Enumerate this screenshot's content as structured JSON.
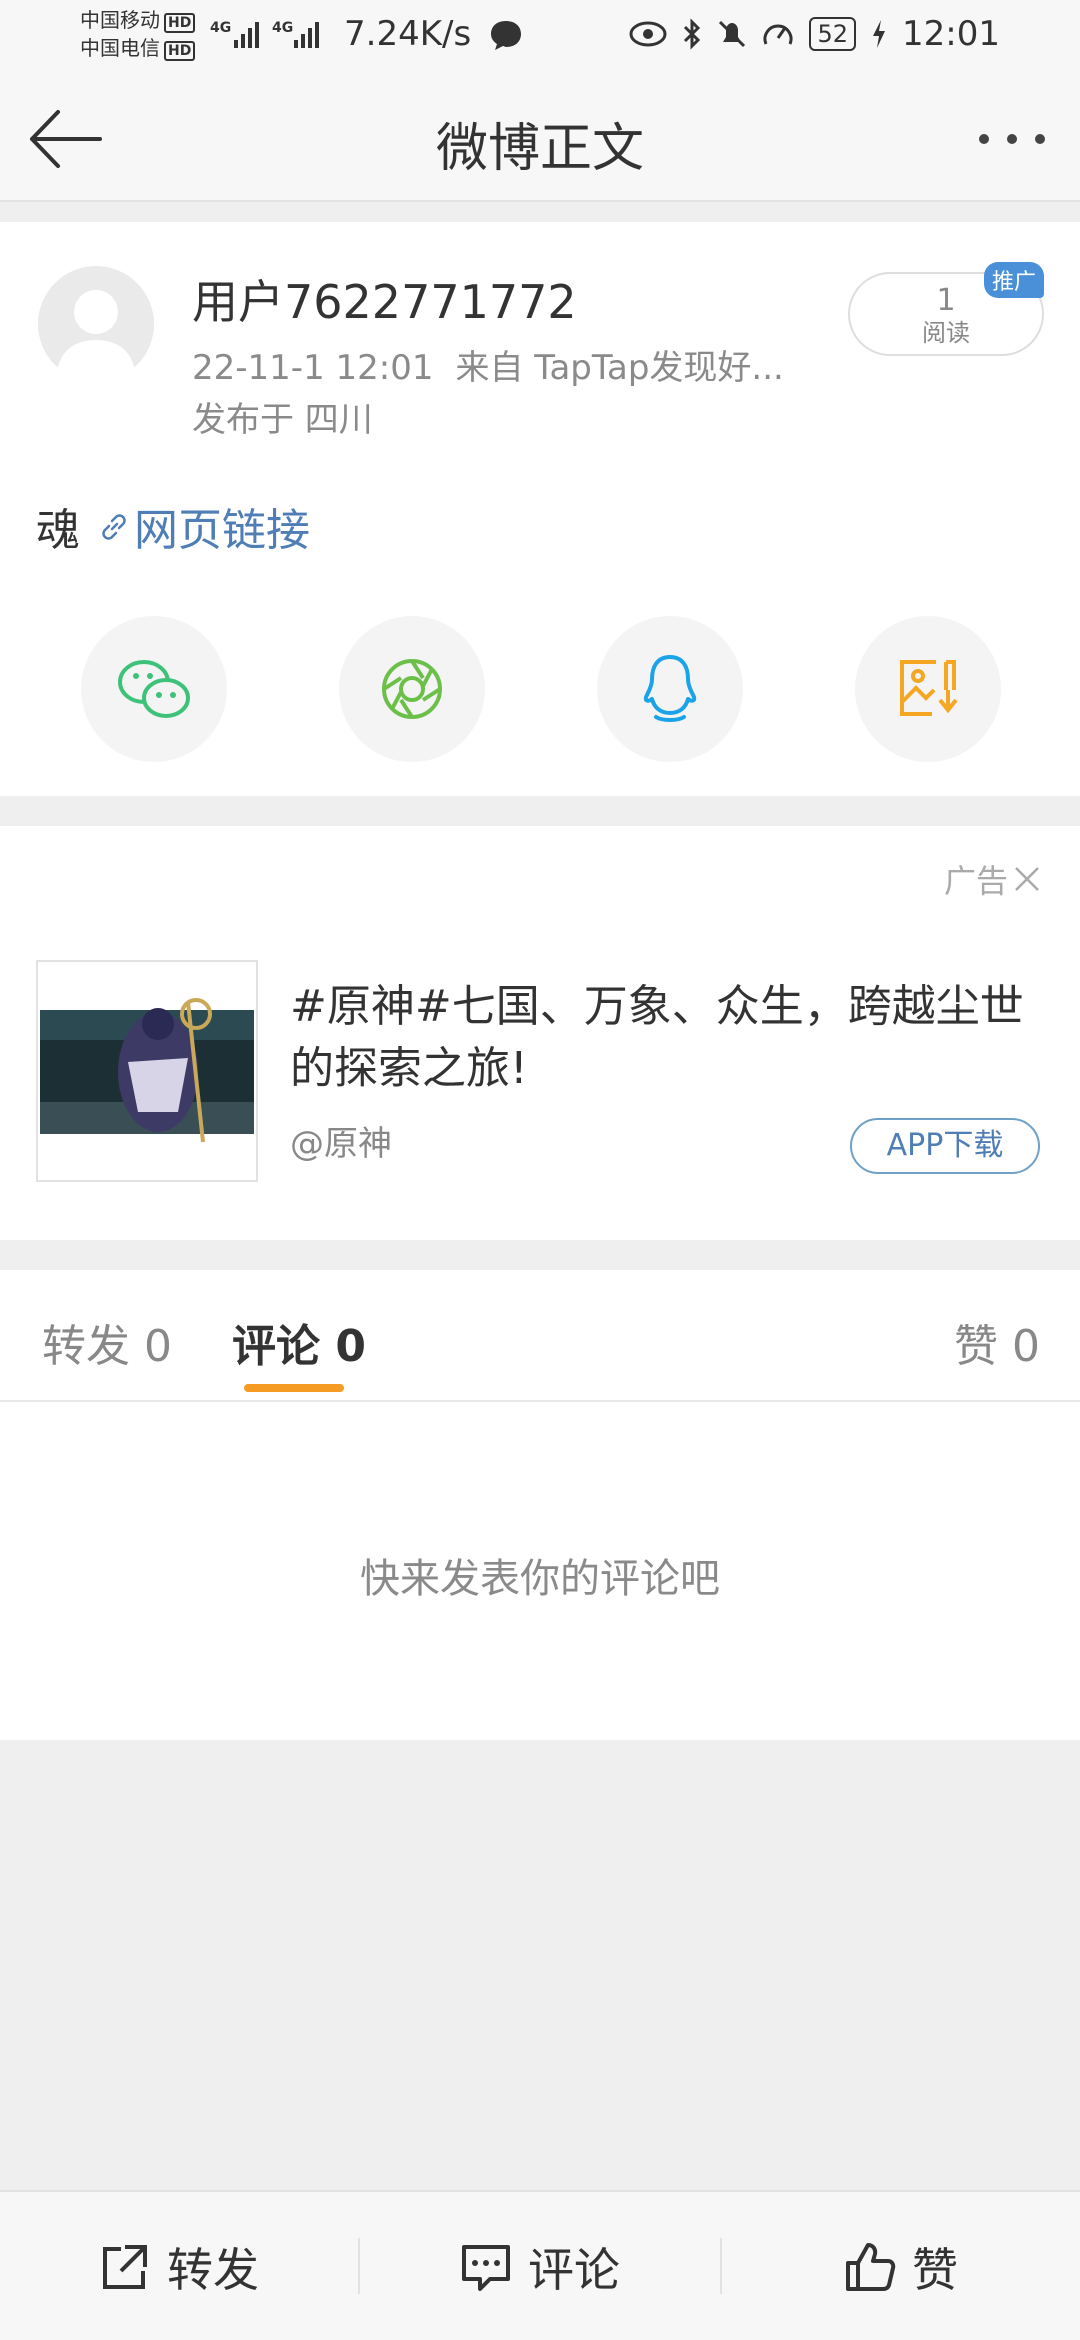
{
  "status_bar": {
    "carrier_1": "中国移动",
    "carrier_2": "中国电信",
    "hd_label": "HD",
    "network_1": "4G",
    "network_2": "4G",
    "speed": "7.24K/s",
    "battery": "52",
    "time": "12:01"
  },
  "nav": {
    "title": "微博正文"
  },
  "post": {
    "username": "用户7622771772",
    "time": "22-11-1 12:01",
    "source": "来自 TapTap发现好...",
    "location": "发布于 四川",
    "read_count": "1",
    "read_label": "阅读",
    "promo_badge": "推广",
    "text": "魂",
    "link_label": "网页链接"
  },
  "share": {
    "items": [
      "wechat-icon",
      "moments-icon",
      "qq-icon",
      "save-image-icon"
    ],
    "colors": {
      "wechat": "#3ec27a",
      "moments": "#6cc04a",
      "qq": "#1aa3e8",
      "save": "#f5a623"
    }
  },
  "ad": {
    "tag": "广告",
    "text": "#原神#七国、万象、众生，跨越尘世的探索之旅!",
    "account": "@原神",
    "button": "APP下载"
  },
  "tabs": {
    "repost": "转发 0",
    "comment": "评论 0",
    "like": "赞 0",
    "empty_hint": "快来发表你的评论吧",
    "accent": "#f59b23"
  },
  "bottom_bar": {
    "repost": "转发",
    "comment": "评论",
    "like": "赞"
  }
}
